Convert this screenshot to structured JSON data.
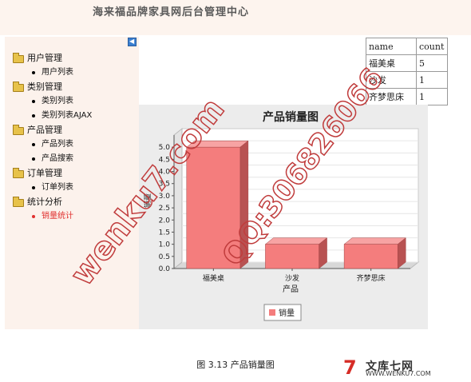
{
  "header": {
    "title": "海来福品牌家具网后台管理中心"
  },
  "sidebar": {
    "groups": [
      {
        "label": "用户管理",
        "items": [
          "用户列表"
        ]
      },
      {
        "label": "类别管理",
        "items": [
          "类别列表",
          "类别列表AJAX"
        ]
      },
      {
        "label": "产品管理",
        "items": [
          "产品列表",
          "产品搜索"
        ]
      },
      {
        "label": "订单管理",
        "items": [
          "订单列表"
        ]
      },
      {
        "label": "统计分析",
        "items": [
          "销量统计"
        ]
      }
    ],
    "active_item": "销量统计"
  },
  "stats_table": {
    "headers": [
      "name",
      "count"
    ],
    "rows": [
      [
        "福美桌",
        "5"
      ],
      [
        "沙发",
        "1"
      ],
      [
        "齐梦思床",
        "1"
      ]
    ]
  },
  "chart_data": {
    "type": "bar",
    "title": "产品销量图",
    "categories": [
      "福美桌",
      "沙发",
      "齐梦思床"
    ],
    "values": [
      5,
      1,
      1
    ],
    "xlabel": "产品",
    "ylabel": "销量",
    "ylim": [
      0,
      5.5
    ],
    "yticks": [
      "0.0",
      "0.5",
      "1.0",
      "1.5",
      "2.0",
      "2.5",
      "3.0",
      "3.5",
      "4.0",
      "4.5",
      "5.0"
    ],
    "series": [
      {
        "name": "销量",
        "values": [
          5,
          1,
          1
        ]
      }
    ],
    "legend": "bottom",
    "grid": true,
    "colors": {
      "bar_front": "#f47d7d",
      "bar_side": "#b85252",
      "bar_top": "#f7a3a3"
    }
  },
  "caption": "图 3.13 产品销量图",
  "watermarks": [
    "wenku7.com",
    "QQ:306826066"
  ],
  "logo": {
    "mark": "7",
    "name": "文库七网",
    "url": "WWW.WENKU7.COM"
  }
}
